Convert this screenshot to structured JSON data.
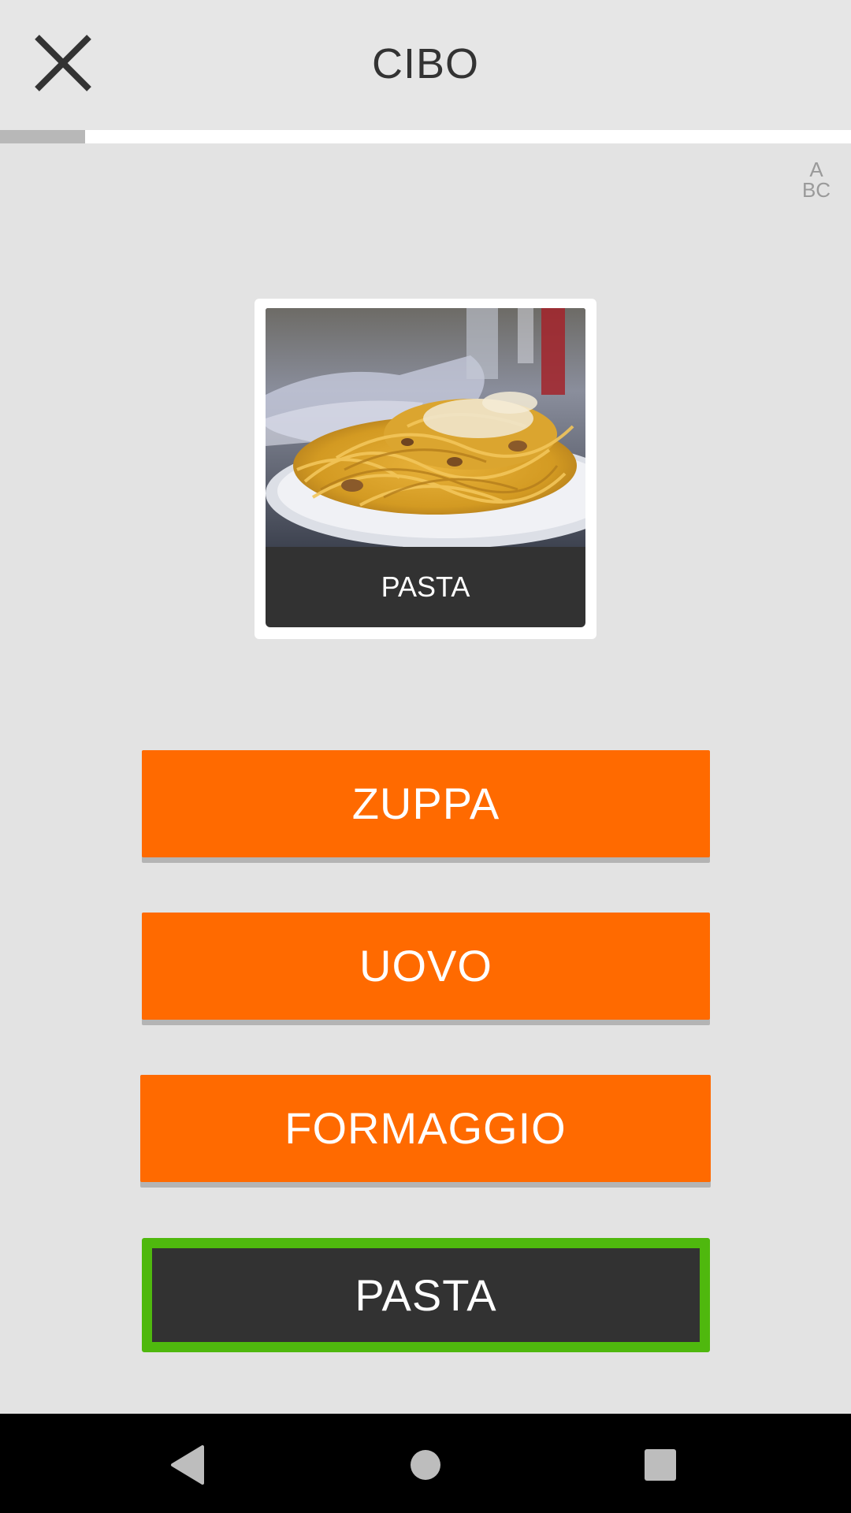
{
  "header": {
    "title": "CIBO",
    "close_icon": "close-icon"
  },
  "progress": {
    "fraction": 0.1
  },
  "script_toggle": {
    "line1": "A",
    "line2": "BC"
  },
  "card": {
    "label": "PASTA",
    "image_icon": "spaghetti-plate-photo"
  },
  "answers": [
    {
      "label": "ZUPPA",
      "state": "default"
    },
    {
      "label": "UOVO",
      "state": "default"
    },
    {
      "label": "FORMAGGIO",
      "state": "default"
    },
    {
      "label": "PASTA",
      "state": "correct"
    }
  ],
  "colors": {
    "accent": "#ff6a00",
    "correct_border": "#4fb80e",
    "dark": "#323232"
  },
  "navbar": {
    "back_icon": "back-triangle-icon",
    "home_icon": "home-circle-icon",
    "recents_icon": "recents-square-icon"
  }
}
